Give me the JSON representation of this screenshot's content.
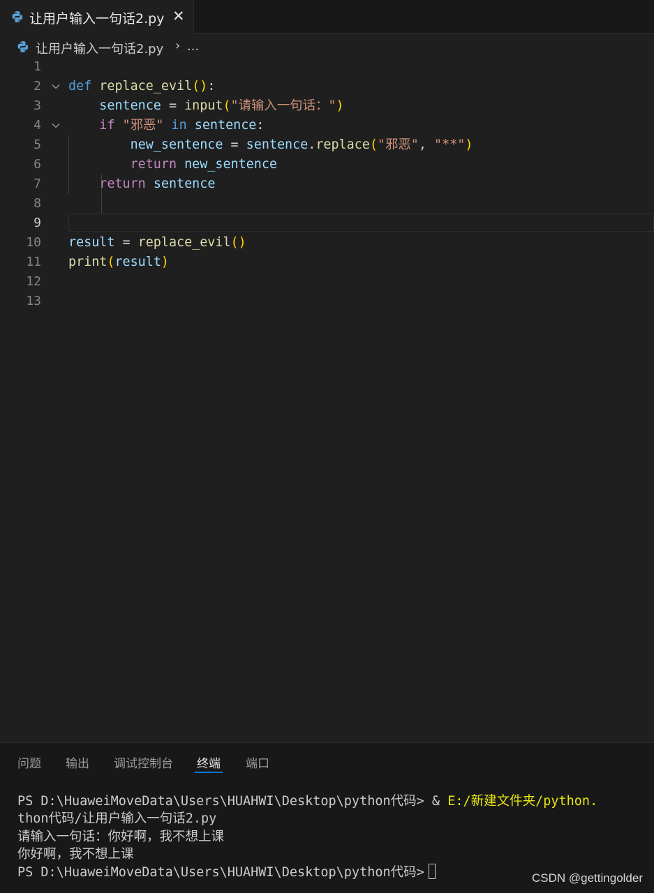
{
  "tab": {
    "filename": "让用户输入一句话2.py",
    "close_glyph": "✕",
    "icon": "python-icon"
  },
  "breadcrumb": {
    "filename": "让用户输入一句话2.py",
    "separator": "›",
    "ellipsis": "..."
  },
  "editor": {
    "active_line": 9,
    "lines": [
      {
        "n": "1",
        "tokens": []
      },
      {
        "n": "2",
        "fold": true,
        "tokens": [
          {
            "t": "def",
            "c": "kw-def"
          },
          {
            "t": " "
          },
          {
            "t": "replace_evil",
            "c": "fn"
          },
          {
            "t": "()",
            "c": "br1"
          },
          {
            "t": ":",
            "c": "op"
          }
        ]
      },
      {
        "n": "3",
        "tokens": [
          {
            "t": "    "
          },
          {
            "t": "sentence",
            "c": "var"
          },
          {
            "t": " = ",
            "c": "op"
          },
          {
            "t": "input",
            "c": "fn"
          },
          {
            "t": "(",
            "c": "br1"
          },
          {
            "t": "\"请输入一句话：\"",
            "c": "str"
          },
          {
            "t": ")",
            "c": "br1"
          }
        ]
      },
      {
        "n": "4",
        "fold": true,
        "tokens": [
          {
            "t": "    "
          },
          {
            "t": "if",
            "c": "kw-ctrl"
          },
          {
            "t": " "
          },
          {
            "t": "\"邪恶\"",
            "c": "str"
          },
          {
            "t": " "
          },
          {
            "t": "in",
            "c": "kw-def"
          },
          {
            "t": " "
          },
          {
            "t": "sentence",
            "c": "var"
          },
          {
            "t": ":",
            "c": "op"
          }
        ]
      },
      {
        "n": "5",
        "tokens": [
          {
            "t": "        "
          },
          {
            "t": "new_sentence",
            "c": "var"
          },
          {
            "t": " = ",
            "c": "op"
          },
          {
            "t": "sentence",
            "c": "var"
          },
          {
            "t": ".",
            "c": "op"
          },
          {
            "t": "replace",
            "c": "fn"
          },
          {
            "t": "(",
            "c": "br1"
          },
          {
            "t": "\"邪恶\"",
            "c": "str"
          },
          {
            "t": ", ",
            "c": "op"
          },
          {
            "t": "\"**\"",
            "c": "str"
          },
          {
            "t": ")",
            "c": "br1"
          }
        ]
      },
      {
        "n": "6",
        "tokens": [
          {
            "t": "        "
          },
          {
            "t": "return",
            "c": "kw-ctrl"
          },
          {
            "t": " "
          },
          {
            "t": "new_sentence",
            "c": "var"
          }
        ]
      },
      {
        "n": "7",
        "tokens": [
          {
            "t": "    "
          },
          {
            "t": "return",
            "c": "kw-ctrl"
          },
          {
            "t": " "
          },
          {
            "t": "sentence",
            "c": "var"
          }
        ]
      },
      {
        "n": "8",
        "tokens": []
      },
      {
        "n": "9",
        "tokens": []
      },
      {
        "n": "10",
        "tokens": [
          {
            "t": "result",
            "c": "var"
          },
          {
            "t": " = ",
            "c": "op"
          },
          {
            "t": "replace_evil",
            "c": "fn"
          },
          {
            "t": "()",
            "c": "br1"
          }
        ]
      },
      {
        "n": "11",
        "tokens": [
          {
            "t": "print",
            "c": "fn"
          },
          {
            "t": "(",
            "c": "br1"
          },
          {
            "t": "result",
            "c": "var"
          },
          {
            "t": ")",
            "c": "br1"
          }
        ]
      },
      {
        "n": "12",
        "tokens": []
      },
      {
        "n": "13",
        "tokens": []
      }
    ]
  },
  "panel": {
    "tabs": [
      "问题",
      "输出",
      "调试控制台",
      "终端",
      "端口"
    ],
    "active_tab": "终端",
    "terminal": {
      "line1_prompt": "PS D:\\HuaweiMoveData\\Users\\HUAHWI\\Desktop\\python代码> ",
      "line1_amp": "& ",
      "line1_path": "E:/新建文件夹/python.",
      "line2": "thon代码/让用户输入一句话2.py",
      "line3": "请输入一句话：你好啊，我不想上课",
      "line4": "你好啊，我不想上课",
      "line5_prompt": "PS D:\\HuaweiMoveData\\Users\\HUAHWI\\Desktop\\python代码>"
    }
  },
  "watermark": "CSDN @gettingolder",
  "colors": {
    "background": "#1f1f1f",
    "keyword": "#569cd6",
    "control": "#c586c0",
    "function": "#dcdcaa",
    "variable": "#9cdcfe",
    "string": "#ce9178",
    "bracket": "#ffd700",
    "accent": "#0078d4"
  }
}
